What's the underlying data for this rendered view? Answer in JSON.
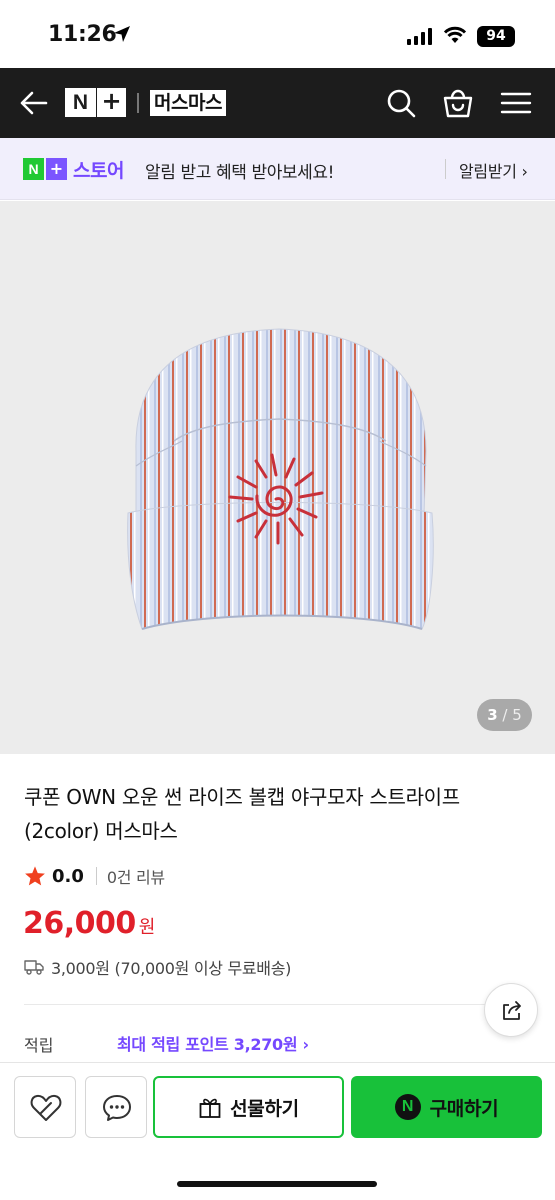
{
  "status_bar": {
    "time": "11:26",
    "battery": "94"
  },
  "nav": {
    "logo_n": "N",
    "logo_plus": "+",
    "brand": "머스마스"
  },
  "store_banner": {
    "logo_n": "N",
    "logo_plus": "+",
    "logo_text": "스토어",
    "promo": "알림 받고 혜택 받아보세요!",
    "notify_label": "알림받기 ›"
  },
  "gallery": {
    "current": "3",
    "separator": " / ",
    "total": "5"
  },
  "product": {
    "title": "쿠폰 OWN 오운 썬 라이즈 볼캡 야구모자 스트라이프 (2color) 머스마스",
    "rating": "0.0",
    "reviews": "0건 리뷰",
    "price": "26,000",
    "price_unit": "원",
    "shipping": "3,000원 (70,000원 이상 무료배송)",
    "points_label": "적립",
    "points_link": "최대 적립 포인트 3,270원 ›"
  },
  "actions": {
    "gift_label": "선물하기",
    "buy_n": "N",
    "buy_label": "구매하기"
  },
  "colors": {
    "green": "#18c13a",
    "purple": "#7548ff",
    "price_red": "#e0202a",
    "nav_bg": "#1c1c1c"
  }
}
